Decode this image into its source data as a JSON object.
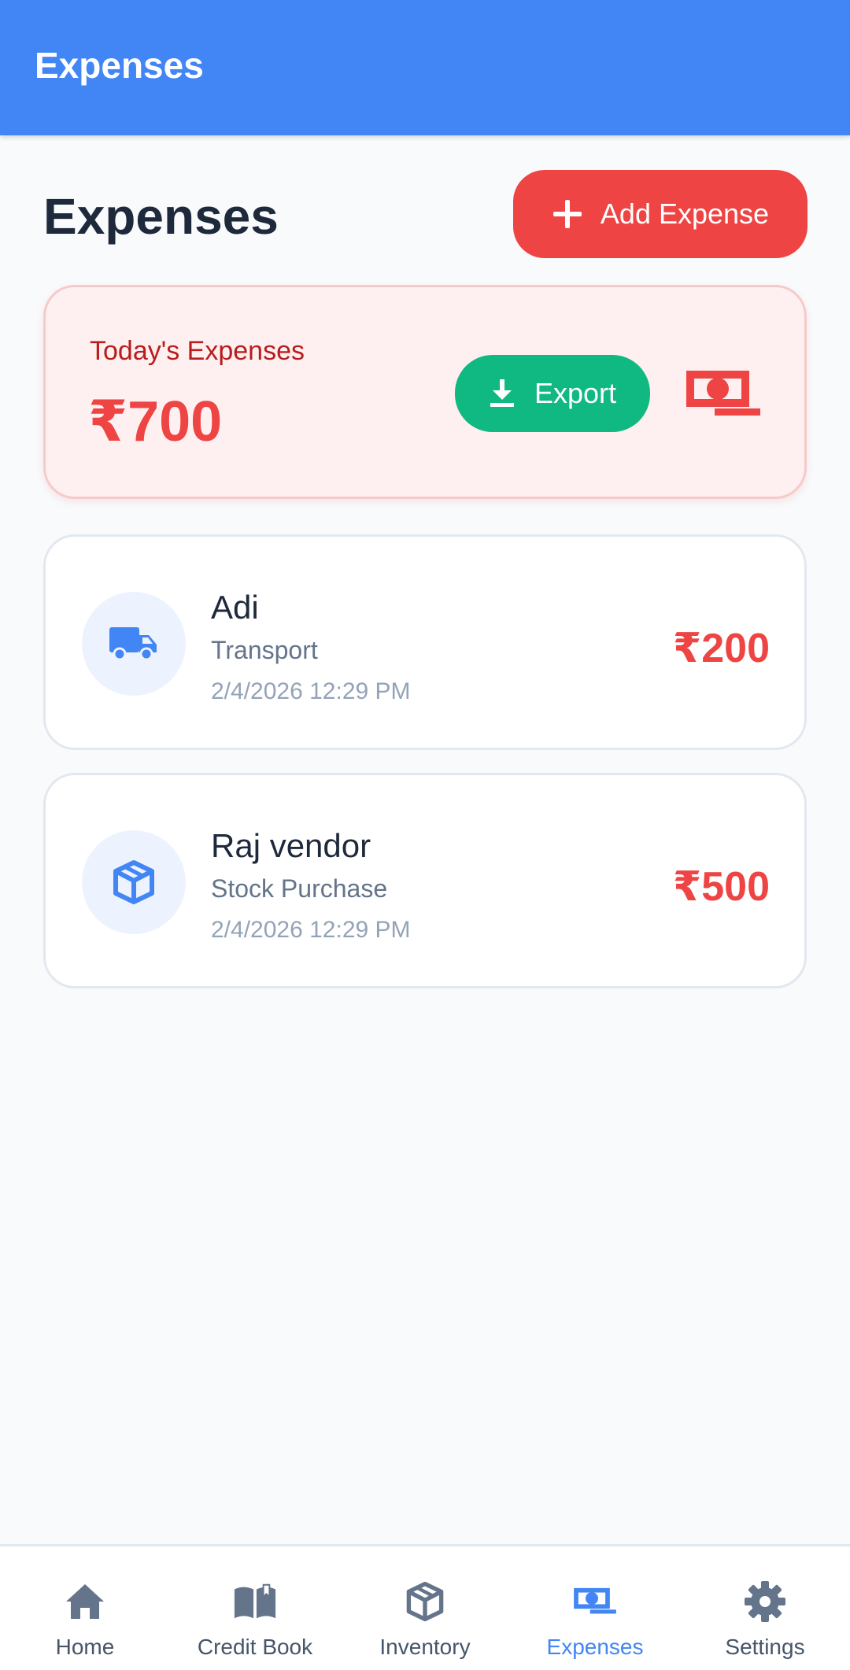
{
  "appbar": {
    "title": "Expenses"
  },
  "header": {
    "title": "Expenses",
    "add_button_label": "Add Expense"
  },
  "summary": {
    "label": "Today's Expenses",
    "amount": "₹700",
    "export_label": "Export"
  },
  "expenses": [
    {
      "name": "Adi",
      "category": "Transport",
      "datetime": "2/4/2026 12:29 PM",
      "amount": "₹200",
      "icon": "truck-icon"
    },
    {
      "name": "Raj vendor",
      "category": "Stock Purchase",
      "datetime": "2/4/2026 12:29 PM",
      "amount": "₹500",
      "icon": "box-icon"
    }
  ],
  "nav": {
    "items": [
      {
        "label": "Home",
        "icon": "home-icon"
      },
      {
        "label": "Credit Book",
        "icon": "book-icon"
      },
      {
        "label": "Inventory",
        "icon": "cube-icon"
      },
      {
        "label": "Expenses",
        "icon": "money-bill-icon",
        "active": true
      },
      {
        "label": "Settings",
        "icon": "gear-icon"
      }
    ]
  },
  "colors": {
    "primary": "#4285f4",
    "danger": "#ef4444",
    "success": "#10b981",
    "summary_bg": "#fef0f0",
    "muted_text": "#64748b"
  }
}
